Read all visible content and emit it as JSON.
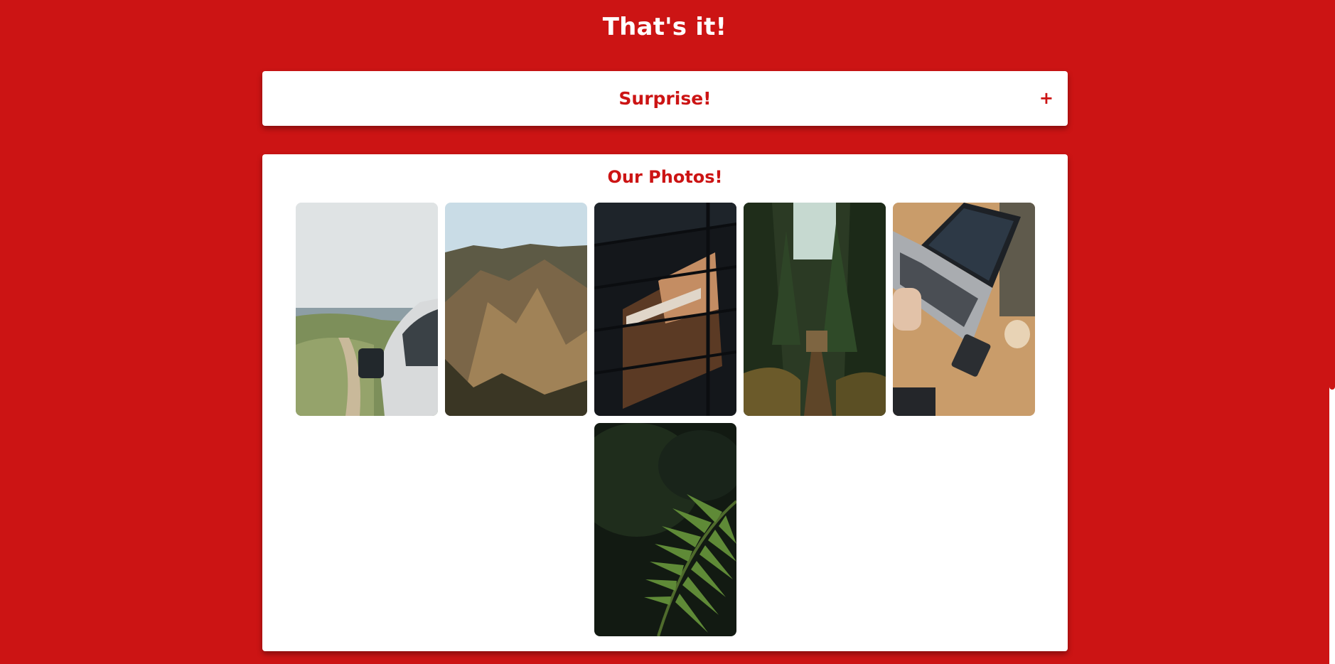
{
  "page": {
    "title": "That's it!"
  },
  "accordion": {
    "label": "Surprise!",
    "toggle_symbol": "+"
  },
  "gallery": {
    "title": "Our Photos!",
    "photos": [
      {
        "name": "photo-van-coast"
      },
      {
        "name": "photo-mountain-ridge"
      },
      {
        "name": "photo-building-reflection"
      },
      {
        "name": "photo-forest-path"
      },
      {
        "name": "photo-laptop-desk"
      },
      {
        "name": "photo-fern"
      }
    ]
  },
  "colors": {
    "accent": "#cc1414",
    "card": "#ffffff"
  }
}
